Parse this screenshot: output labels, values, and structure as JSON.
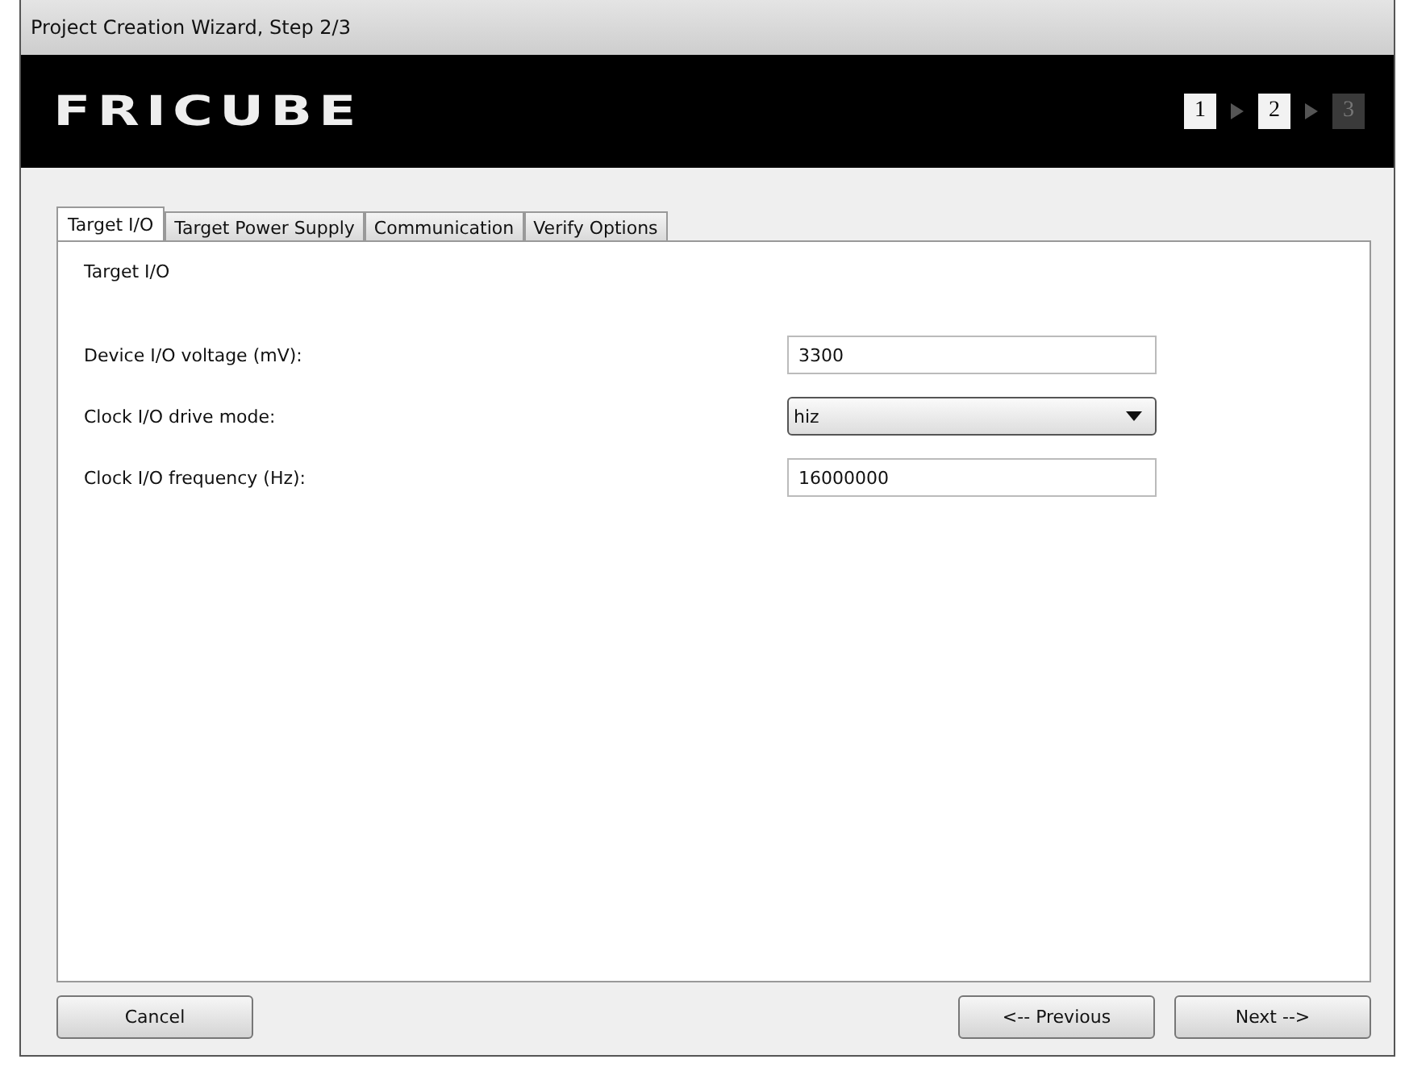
{
  "window": {
    "title": "Project Creation Wizard, Step 2/3"
  },
  "header": {
    "logo": "FRICUBE",
    "steps": [
      {
        "label": "1",
        "enabled": true
      },
      {
        "label": "2",
        "enabled": true
      },
      {
        "label": "3",
        "enabled": false
      }
    ]
  },
  "tabs": [
    {
      "label": "Target I/O",
      "selected": true
    },
    {
      "label": "Target Power Supply",
      "selected": false
    },
    {
      "label": "Communication",
      "selected": false
    },
    {
      "label": "Verify Options",
      "selected": false
    }
  ],
  "section_title": "Target I/O",
  "fields": [
    {
      "label": "Device I/O voltage (mV):",
      "kind": "text",
      "value": "3300"
    },
    {
      "label": "Clock I/O drive mode:",
      "kind": "select",
      "value": "hiz"
    },
    {
      "label": "Clock I/O frequency (Hz):",
      "kind": "text",
      "value": "16000000"
    }
  ],
  "buttons": {
    "cancel": "Cancel",
    "previous": "<-- Previous",
    "next": "Next -->"
  }
}
